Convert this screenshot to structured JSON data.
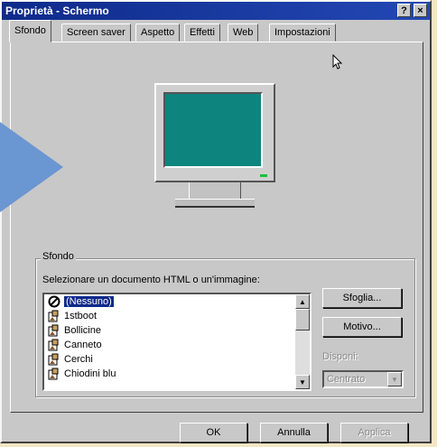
{
  "window": {
    "title": "Proprietà - Schermo",
    "help_btn": "?",
    "close_btn": "×"
  },
  "tabs": [
    {
      "label": "Sfondo",
      "active": true
    },
    {
      "label": "Screen saver"
    },
    {
      "label": "Aspetto"
    },
    {
      "label": "Effetti"
    },
    {
      "label": "Web"
    },
    {
      "label": "Impostazioni"
    }
  ],
  "wallpaper": {
    "group_label": "Sfondo",
    "instruction": "Selezionare un documento HTML o un'immagine:",
    "items": [
      {
        "label": "(Nessuno)",
        "icon": "none-icon",
        "selected": true
      },
      {
        "label": "1stboot",
        "icon": "image-file-icon"
      },
      {
        "label": "Bollicine",
        "icon": "image-file-icon"
      },
      {
        "label": "Canneto",
        "icon": "image-file-icon"
      },
      {
        "label": "Cerchi",
        "icon": "image-file-icon"
      },
      {
        "label": "Chiodini blu",
        "icon": "image-file-icon"
      }
    ],
    "browse_button": "Sfoglia...",
    "pattern_button": "Motivo...",
    "display_label": "Disponi:",
    "display_value": "Centrato"
  },
  "footer": {
    "ok": "OK",
    "cancel": "Annulla",
    "apply": "Applica"
  },
  "colors": {
    "titlebar": "#0e2a8a",
    "desktop": "#0e847e",
    "selection": "#0e2a8a",
    "arrow": "#6a96d2"
  }
}
